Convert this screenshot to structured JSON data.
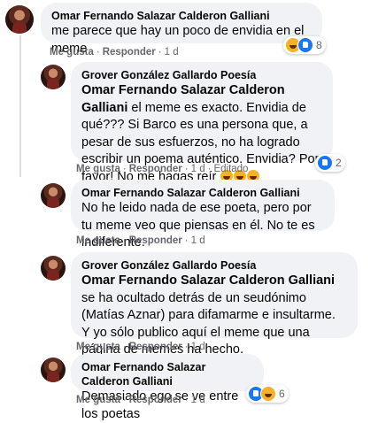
{
  "labels": {
    "like": "Me gusta",
    "reply": "Responder",
    "separator": "·"
  },
  "comments": [
    {
      "author": "Omar Fernando Salazar Calderon Galliani",
      "mention": "",
      "text": "me parece que hay un poco de envidia en el meme",
      "time": "1 d",
      "edited": "",
      "reactions": [
        "haha",
        "like"
      ],
      "reaction_count": "8"
    },
    {
      "author": "Grover González Gallardo Poesía",
      "mention": "Omar Fernando Salazar Calderon Galliani",
      "text": " el meme es exacto. Envidia de qué??? Si Barco es una persona que, a pesar de sus esfuerzos, no ha logrado escribir un poema auténtico. Envidia? Por favor! No me hagas reír ",
      "emojis": [
        "haha",
        "haha",
        "haha"
      ],
      "time": "1 d",
      "edited": "Editado",
      "reactions": [
        "like"
      ],
      "reaction_count": "2"
    },
    {
      "author": "Omar Fernando Salazar Calderon Galliani",
      "mention": "",
      "text": "No he leido nada de ese poeta, pero por tu meme veo que piensas en él. No te es indiferente.",
      "time": "1 d",
      "edited": "",
      "reactions": [],
      "reaction_count": ""
    },
    {
      "author": "Grover González Gallardo Poesía",
      "mention": "Omar Fernando Salazar Calderon Galliani",
      "text": " se ha ocultado detrás de un seudónimo (Matías Aznar) para difamarme e insultarme. Y yo sólo publico aquí el meme que una página de memes ha hecho.",
      "time": "1 d",
      "edited": "",
      "reactions": [],
      "reaction_count": ""
    },
    {
      "author": "Omar Fernando Salazar Calderon Galliani",
      "mention": "",
      "text": "Demasiado ego se ve entre los poetas",
      "time": "1 d",
      "edited": "",
      "reactions": [
        "like",
        "haha"
      ],
      "reaction_count": "6"
    }
  ],
  "colors": {
    "bubble": "#f0f2f5",
    "meta": "#65676b",
    "like": "#1877f2",
    "haha": "#f7b125"
  }
}
